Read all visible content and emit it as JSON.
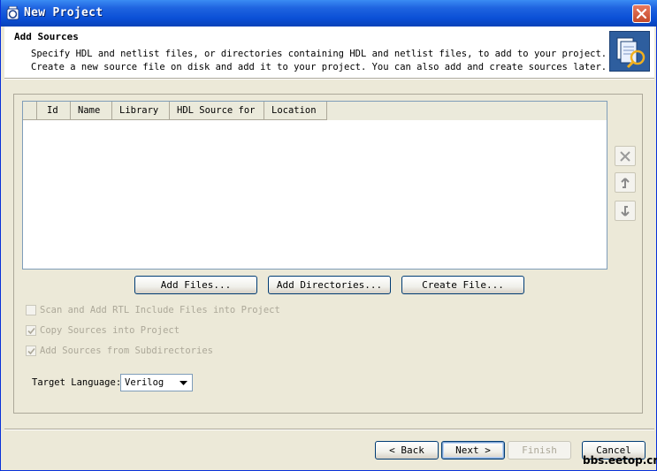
{
  "window": {
    "title": "New Project"
  },
  "header": {
    "title": "Add Sources",
    "desc_line1": "Specify HDL and netlist files, or directories containing HDL and netlist files, to add to your project.",
    "desc_line2": "Create a new source file on disk and add it to your project. You can also add and create sources later."
  },
  "table": {
    "columns": [
      "Id",
      "Name",
      "Library",
      "HDL Source for",
      "Location"
    ],
    "rows": []
  },
  "actions": {
    "add_files": "Add Files...",
    "add_directories": "Add Directories...",
    "create_file": "Create File..."
  },
  "options": [
    {
      "label": "Scan and Add RTL Include Files into Project",
      "checked": false
    },
    {
      "label": "Copy Sources into Project",
      "checked": true
    },
    {
      "label": "Add Sources from Subdirectories",
      "checked": true
    }
  ],
  "target_language": {
    "label": "Target Language:",
    "value": "Verilog"
  },
  "footer": {
    "back": "< Back",
    "next": "Next >",
    "finish": "Finish",
    "cancel": "Cancel"
  },
  "watermark": "bbs.eetop.cn",
  "colors": {
    "titlebar": "#0a4fd6",
    "dialog_bg": "#ece9d8",
    "close": "#c44a2a"
  }
}
